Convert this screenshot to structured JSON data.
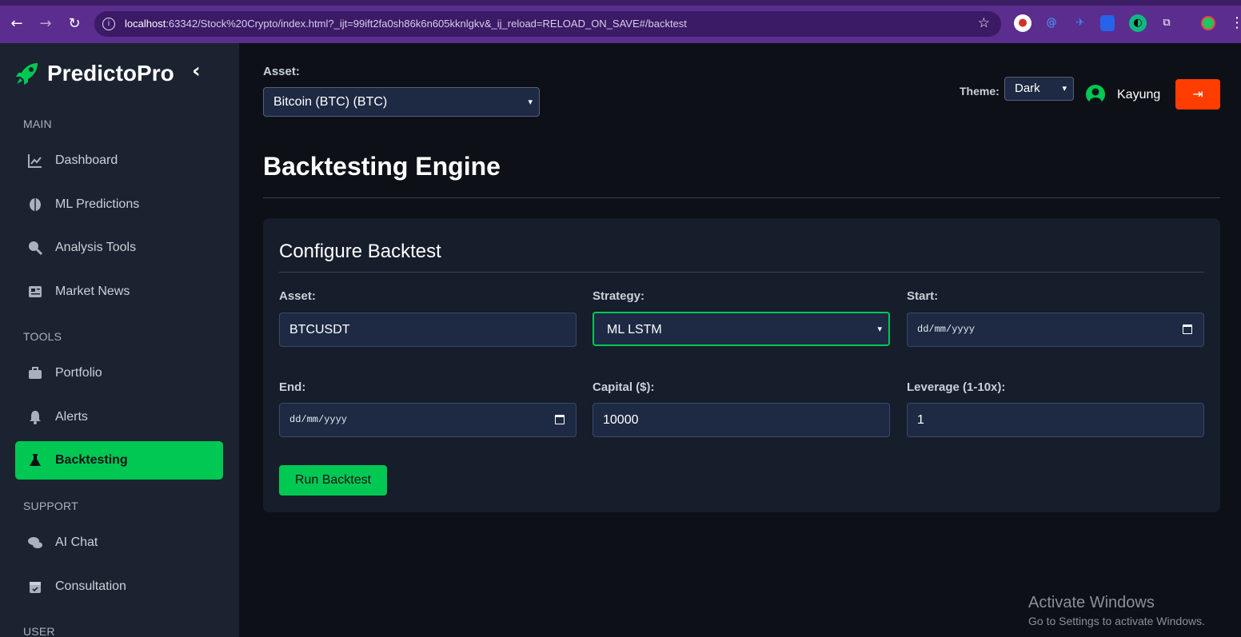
{
  "browser": {
    "url_host": "localhost",
    "url_rest": ":63342/Stock%20Crypto/index.html?_ijt=99ift2fa0sh86k6n605kknlgkv&_ij_reload=RELOAD_ON_SAVE#/backtest"
  },
  "sidebar": {
    "brand": "PredictoPro",
    "sections": {
      "main": "MAIN",
      "tools": "TOOLS",
      "support": "SUPPORT",
      "user": "USER"
    },
    "items": [
      {
        "label": "Dashboard",
        "icon": "chart-line-icon"
      },
      {
        "label": "ML Predictions",
        "icon": "brain-icon"
      },
      {
        "label": "Analysis Tools",
        "icon": "search-chart-icon"
      },
      {
        "label": "Market News",
        "icon": "newspaper-icon"
      },
      {
        "label": "Portfolio",
        "icon": "briefcase-icon"
      },
      {
        "label": "Alerts",
        "icon": "bell-icon"
      },
      {
        "label": "Backtesting",
        "icon": "flask-icon",
        "active": true
      },
      {
        "label": "AI Chat",
        "icon": "chat-icon"
      },
      {
        "label": "Consultation",
        "icon": "calendar-icon"
      }
    ]
  },
  "header": {
    "asset_label": "Asset:",
    "asset_value": "Bitcoin (BTC) (BTC)",
    "theme_label": "Theme:",
    "theme_value": "Dark",
    "user_name": "Kayung"
  },
  "page": {
    "title": "Backtesting Engine"
  },
  "card": {
    "title": "Configure Backtest",
    "fields": {
      "asset": {
        "label": "Asset:",
        "value": "BTCUSDT"
      },
      "strategy": {
        "label": "Strategy:",
        "value": "ML LSTM"
      },
      "start": {
        "label": "Start:",
        "value": "dd/mm/yyyy"
      },
      "end": {
        "label": "End:",
        "value": "dd/mm/yyyy"
      },
      "capital": {
        "label": "Capital ($):",
        "value": "10000"
      },
      "leverage": {
        "label": "Leverage (1-10x):",
        "value": "1"
      }
    },
    "run_label": "Run Backtest"
  },
  "watermark": {
    "line1": "Activate Windows",
    "line2": "Go to Settings to activate Windows."
  },
  "colors": {
    "accent": "#00c853",
    "danger": "#ff3d00",
    "browser": "#5b2d8e"
  }
}
